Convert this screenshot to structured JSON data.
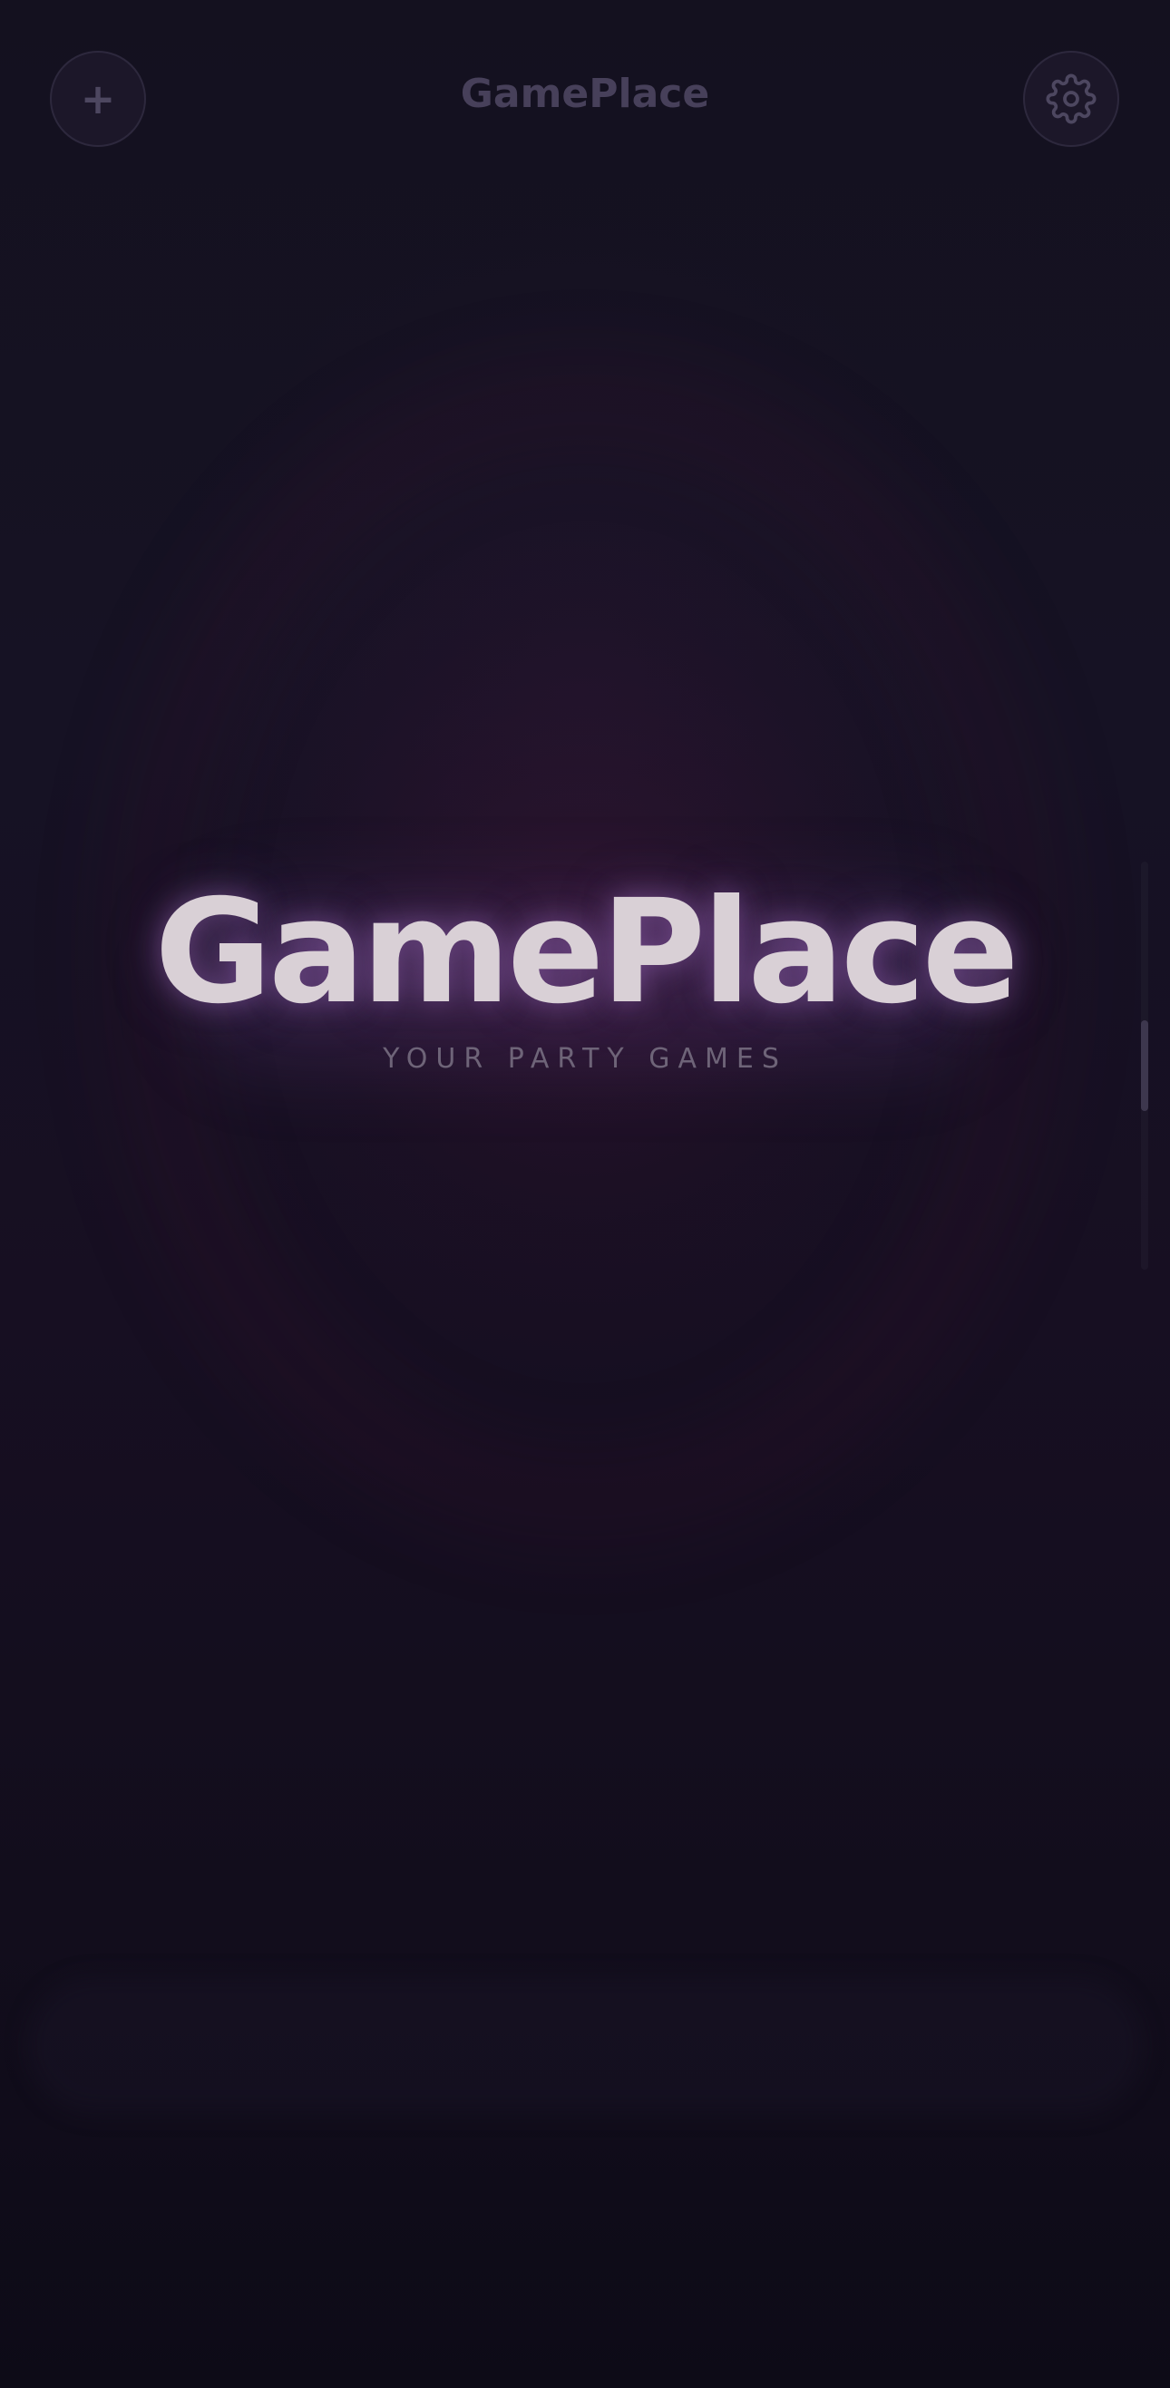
{
  "header": {
    "title": "GamePlace",
    "add_icon": "plus-icon",
    "settings_icon": "gear-icon"
  },
  "hero": {
    "title": "GamePlace",
    "subtitle": "YOUR PARTY GAMES"
  },
  "colors": {
    "background": "#130f1f",
    "hero_text": "#d9d0d6",
    "subtitle_text": "#6e6478",
    "header_text": "#47405a",
    "glow": "#6e468c"
  }
}
